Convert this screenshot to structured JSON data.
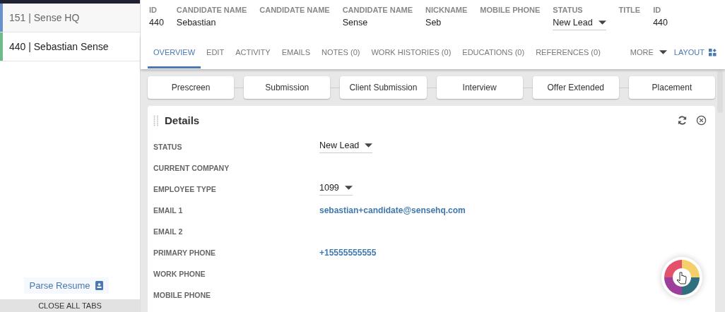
{
  "sidebar": {
    "tabs": [
      {
        "label": "151 | Sense HQ",
        "selected": false,
        "color": "#6b8fc9"
      },
      {
        "label": "440 | Sebastian Sense",
        "selected": true,
        "color": "#6dbb8a"
      }
    ],
    "parse_resume": "Parse Resume",
    "close_all": "CLOSE ALL TABS"
  },
  "header": {
    "fields": [
      {
        "label": "ID",
        "value": "440",
        "kind": "text"
      },
      {
        "label": "CANDIDATE NAME",
        "value": "Sebastian",
        "kind": "text"
      },
      {
        "label": "CANDIDATE NAME"
      },
      {
        "label": "CANDIDATE NAME",
        "value": "Sense",
        "kind": "text"
      },
      {
        "label": "NICKNAME",
        "value": "Seb",
        "kind": "text"
      },
      {
        "label": "MOBILE PHONE"
      },
      {
        "label": "STATUS",
        "value": "New Lead",
        "kind": "dropdown"
      },
      {
        "label": "TITLE"
      },
      {
        "label": "ID",
        "value": "440",
        "kind": "text"
      }
    ]
  },
  "tabs": [
    {
      "label": "OVERVIEW",
      "selected": true
    },
    {
      "label": "EDIT",
      "selected": false
    },
    {
      "label": "ACTIVITY",
      "selected": false
    },
    {
      "label": "EMAILS",
      "selected": false
    },
    {
      "label": "NOTES (0)",
      "selected": false
    },
    {
      "label": "WORK HISTORIES (0)",
      "selected": false
    },
    {
      "label": "EDUCATIONS (0)",
      "selected": false
    },
    {
      "label": "REFERENCES (0)",
      "selected": false
    }
  ],
  "more": "MORE",
  "layout": "LAYOUT",
  "pipeline": [
    "Prescreen",
    "Submission",
    "Client Submission",
    "Interview",
    "Offer Extended",
    "Placement"
  ],
  "details": {
    "title": "Details",
    "rows": [
      {
        "label": "STATUS",
        "value": "New Lead",
        "kind": "dropdown"
      },
      {
        "label": "CURRENT COMPANY"
      },
      {
        "label": "EMPLOYEE TYPE",
        "value": "1099",
        "kind": "dropdown"
      },
      {
        "label": "EMAIL 1",
        "value": "sebastian+candidate@sensehq.com",
        "kind": "link"
      },
      {
        "label": "EMAIL 2"
      },
      {
        "label": "PRIMARY PHONE",
        "value": "+15555555555",
        "kind": "link"
      },
      {
        "label": "WORK PHONE"
      },
      {
        "label": "MOBILE PHONE"
      }
    ]
  }
}
